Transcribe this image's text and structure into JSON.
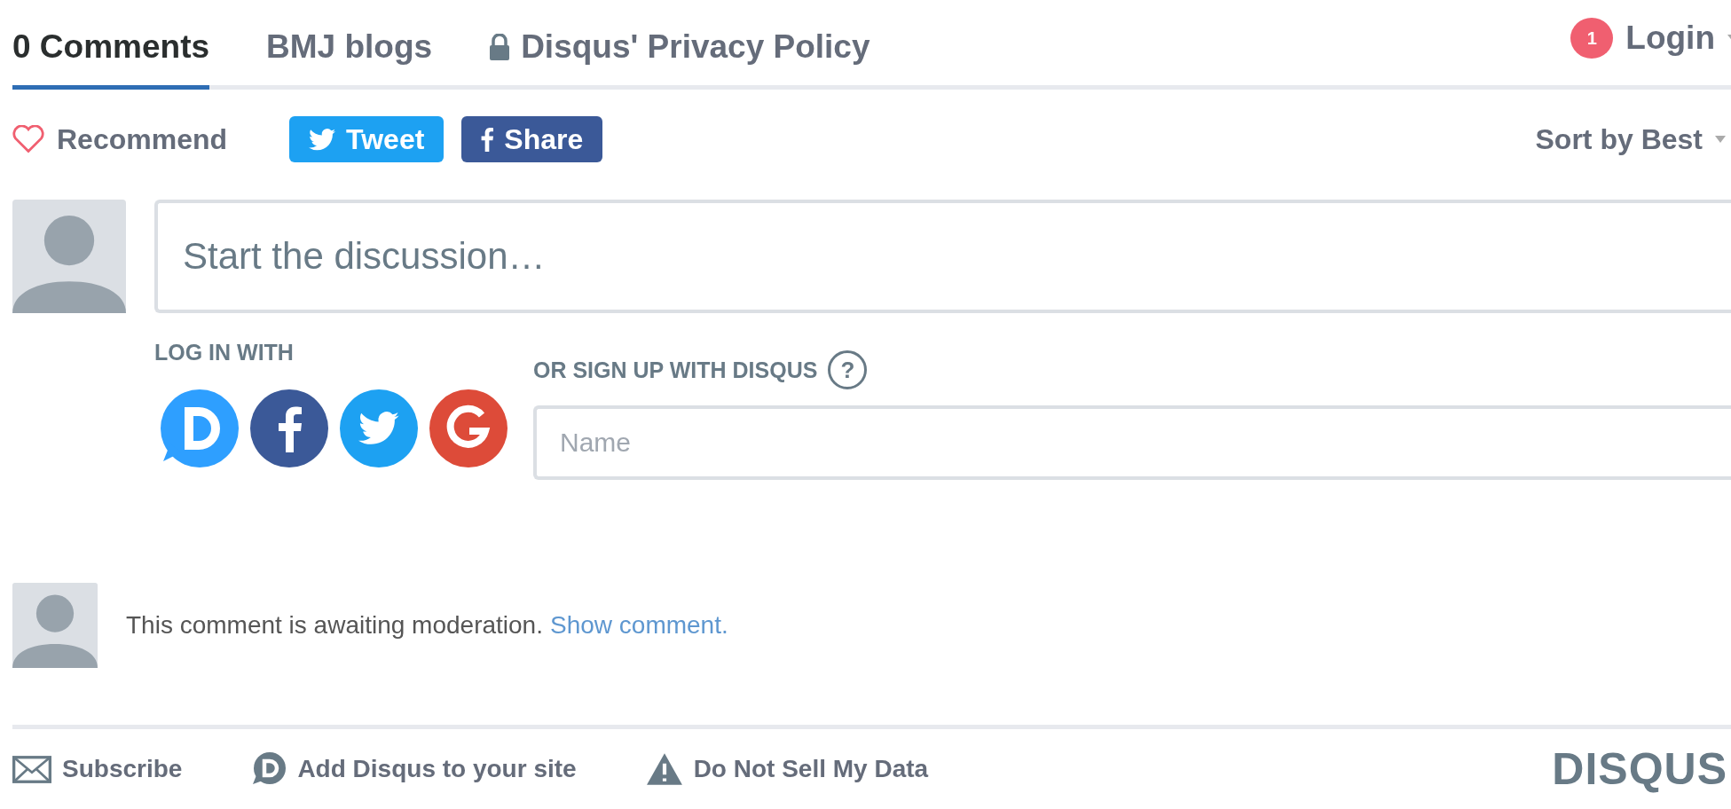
{
  "tabs": [
    {
      "label": "0 Comments",
      "selected": true,
      "kind": "plain"
    },
    {
      "label": "BMJ blogs",
      "selected": false,
      "kind": "plain"
    },
    {
      "label": "Disqus' Privacy Policy",
      "selected": false,
      "kind": "lock"
    }
  ],
  "login": {
    "badge": "1",
    "label": "Login"
  },
  "recommend": {
    "label": "Recommend"
  },
  "share_buttons": [
    {
      "kind": "twitter",
      "label": "Tweet"
    },
    {
      "kind": "facebook",
      "label": "Share"
    }
  ],
  "sort": {
    "label": "Sort by Best"
  },
  "composer": {
    "placeholder": "Start the discussion…"
  },
  "login_with": {
    "label": "LOG IN WITH",
    "providers": [
      {
        "kind": "disqus"
      },
      {
        "kind": "facebook"
      },
      {
        "kind": "twitter"
      },
      {
        "kind": "google"
      }
    ]
  },
  "signup": {
    "label": "OR SIGN UP WITH DISQUS",
    "help": "?",
    "name_placeholder": "Name"
  },
  "comments": [
    {
      "text": "This comment is awaiting moderation.",
      "link": "Show comment."
    }
  ],
  "footer": [
    {
      "kind": "mail",
      "label": "Subscribe"
    },
    {
      "kind": "disqus",
      "label": "Add Disqus to your site"
    },
    {
      "kind": "warning",
      "label": "Do Not Sell My Data"
    }
  ],
  "logo": "DISQUS"
}
